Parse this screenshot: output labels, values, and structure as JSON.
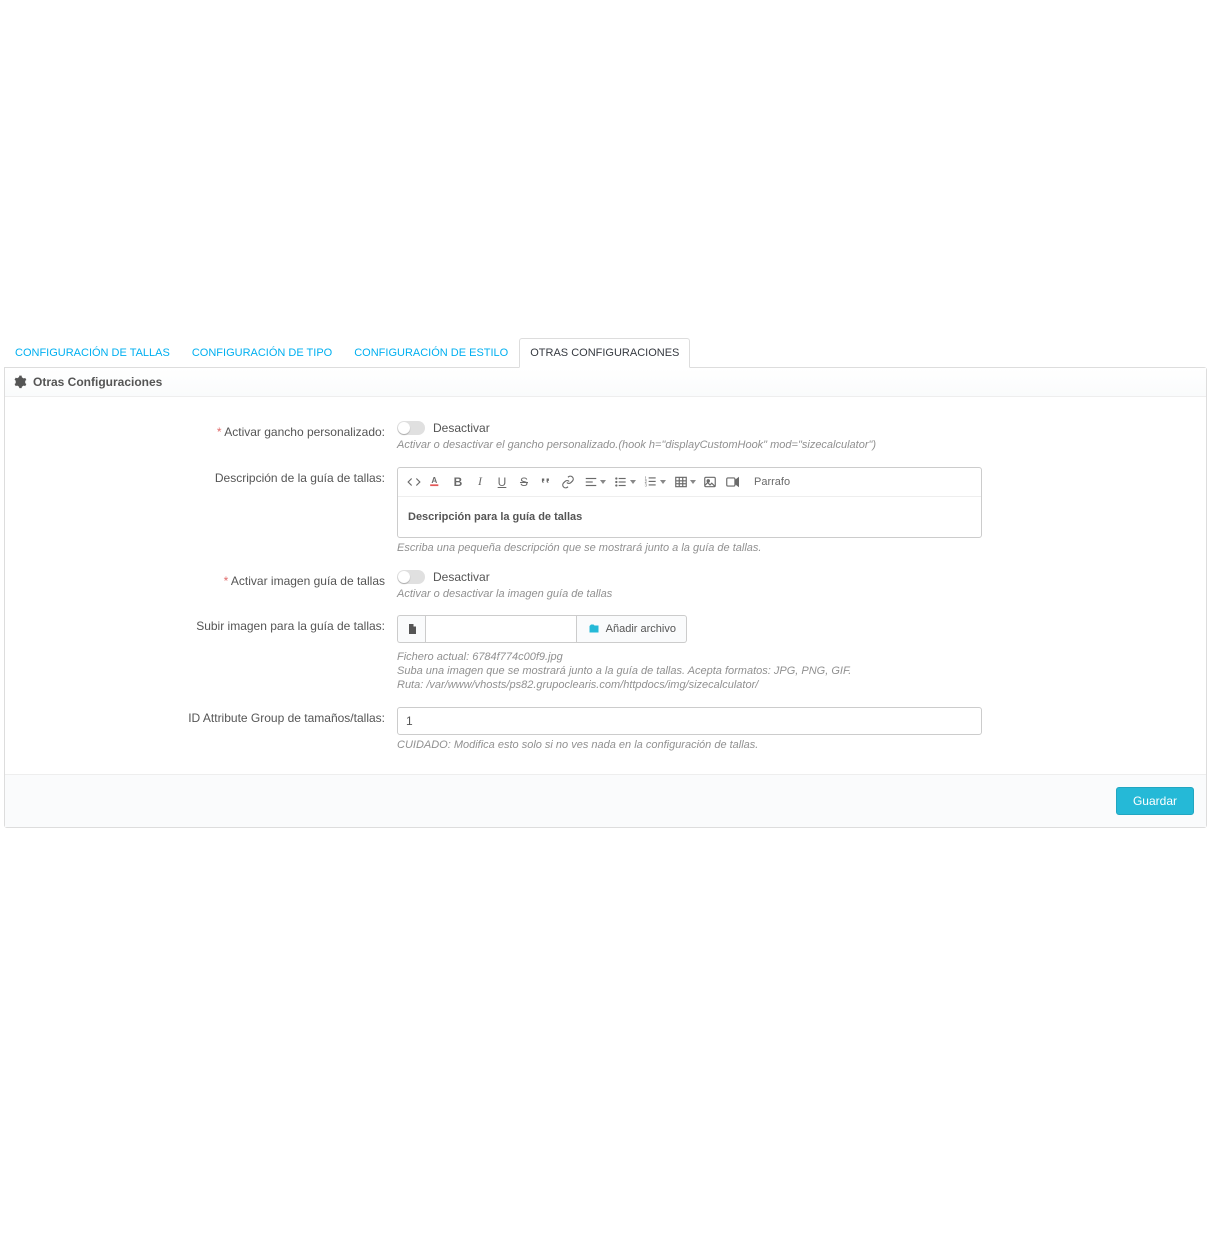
{
  "tabs": [
    "Configuración de Tallas",
    "Configuración de Tipo",
    "Configuración de Estilo",
    "Otras Configuraciones"
  ],
  "panel_title": "Otras Configuraciones",
  "form": {
    "hook": {
      "label": "Activar gancho personalizado:",
      "state_label": "Desactivar",
      "help": "Activar o desactivar el gancho personalizado.(hook h=\"displayCustomHook\" mod=\"sizecalculator\")"
    },
    "desc": {
      "label": "Descripción de la guía de tallas:",
      "content": "Descripción para la guía de tallas",
      "help": "Escriba una pequeña descripción que se mostrará junto a la guía de tallas.",
      "paragraph_label": "Parrafo"
    },
    "activate_image": {
      "label": "Activar imagen guía de tallas",
      "state_label": "Desactivar",
      "help": "Activar o desactivar la imagen guía de tallas"
    },
    "upload_image": {
      "label": "Subir imagen para la guía de tallas:",
      "button_label": "Añadir archivo",
      "help_1": "Fichero actual: 6784f774c00f9.jpg",
      "help_2": "Suba una imagen que se mostrará junto a la guía de tallas. Acepta formatos: JPG, PNG, GIF.",
      "help_3": "Ruta: /var/www/vhosts/ps82.grupoclearis.com/httpdocs/img/sizecalculator/"
    },
    "attr_group": {
      "label": "ID Attribute Group de tamaños/tallas:",
      "value": "1",
      "help": "CUIDADO: Modifica esto solo si no ves nada en la configuración de tallas."
    }
  },
  "save_label": "Guardar"
}
